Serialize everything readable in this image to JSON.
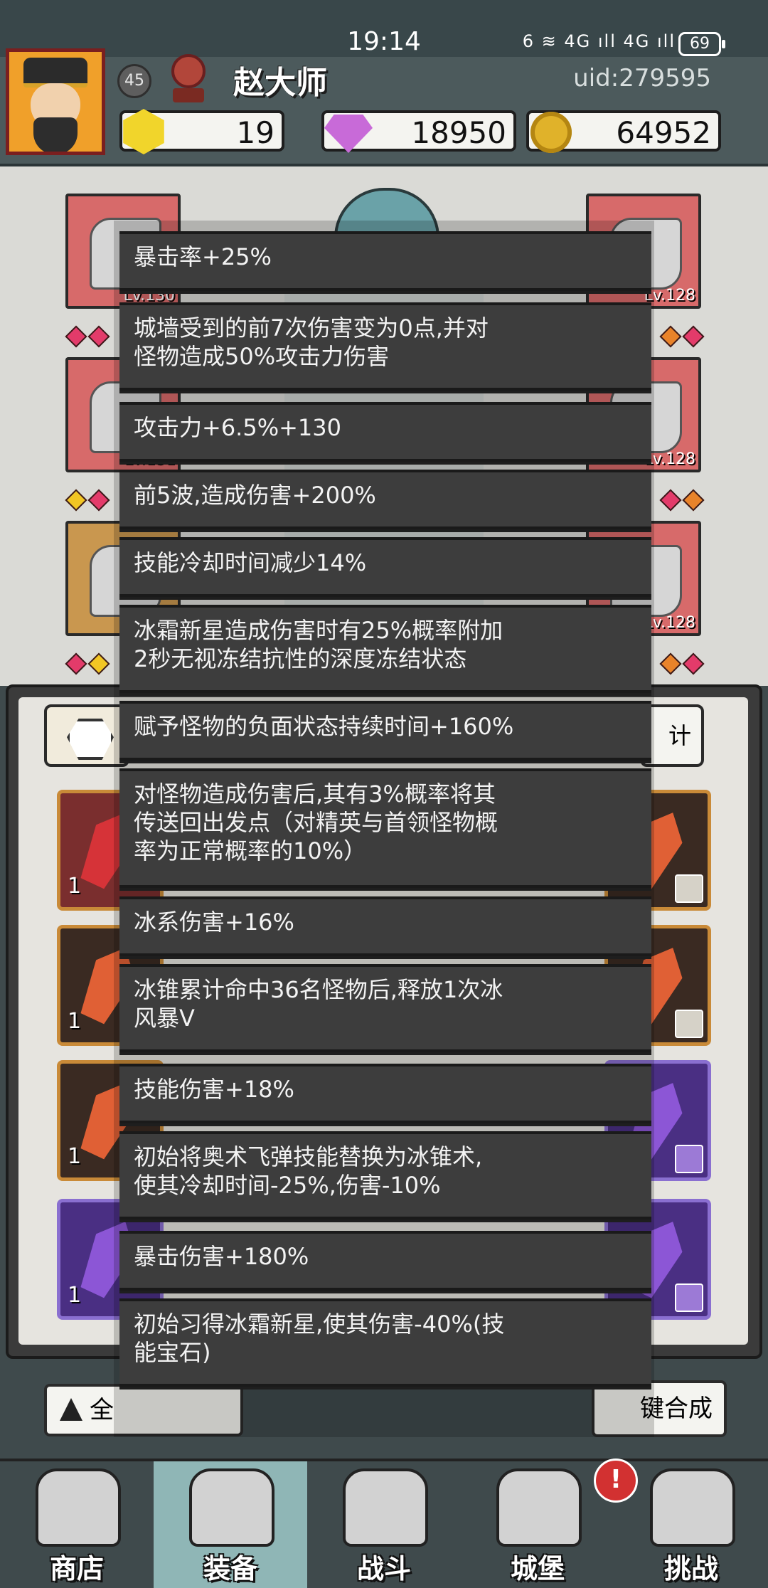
{
  "status_bar": {
    "time": "19:14",
    "signal": "6 ≋ 4G ıll 4G ıll",
    "battery": "69"
  },
  "player": {
    "level": "45",
    "name": "赵大师",
    "uid": "uid:279595"
  },
  "currencies": {
    "gem": "19",
    "diamond": "18950",
    "gold": "64952"
  },
  "equipment": {
    "slots": [
      {
        "level": "Lv.130"
      },
      {
        "level": "Lv.131"
      },
      {
        "level": ""
      },
      {
        "level": "Lv.128"
      },
      {
        "level": "Lv.128"
      },
      {
        "level": "Lv.128"
      }
    ]
  },
  "inventory": {
    "stats_label": "计",
    "counts": [
      "1",
      "1",
      "1",
      "1"
    ],
    "all_label": "全",
    "merge_label": "键合成"
  },
  "tooltip": {
    "affixes": [
      "暴击率+25%",
      "城墙受到的前7次伤害变为0点,并对\n怪物造成50%攻击力伤害",
      "攻击力+6.5%+130",
      "前5波,造成伤害+200%",
      "技能冷却时间减少14%",
      "冰霜新星造成伤害时有25%概率附加\n2秒无视冻结抗性的深度冻结状态",
      "赋予怪物的负面状态持续时间+160%",
      "对怪物造成伤害后,其有3%概率将其\n传送回出发点（对精英与首领怪物概\n率为正常概率的10%）",
      "冰系伤害+16%",
      "冰锥累计命中36名怪物后,释放1次冰\n风暴V",
      "技能伤害+18%",
      "初始将奥术飞弹技能替换为冰锥术,\n使其冷却时间-25%,伤害-10%",
      "暴击伤害+180%",
      "初始习得冰霜新星,使其伤害-40%(技\n能宝石)"
    ]
  },
  "nav": {
    "items": [
      "商店",
      "装备",
      "战斗",
      "城堡",
      "挑战"
    ],
    "alert": "!"
  }
}
